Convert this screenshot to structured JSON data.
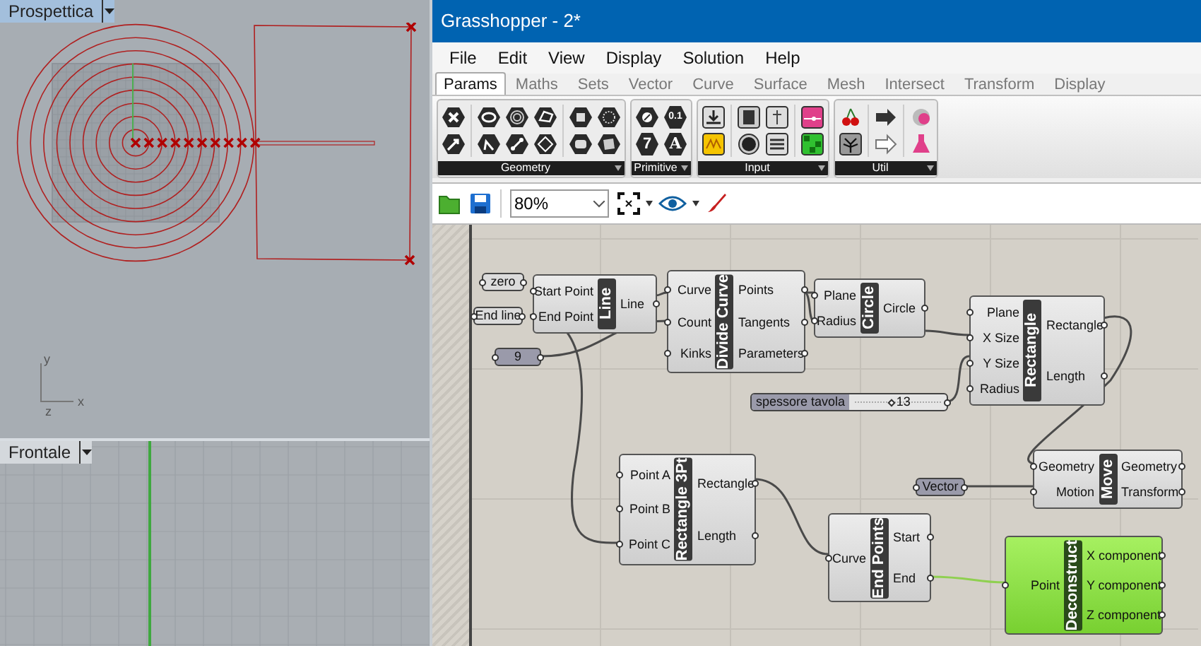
{
  "viewports": [
    {
      "label": "Prospettica",
      "selected": true,
      "axes": [
        "y",
        "x",
        "z"
      ]
    },
    {
      "label": "Frontale",
      "selected": false
    }
  ],
  "window": {
    "title": "Grasshopper - 2*"
  },
  "menu": [
    "File",
    "Edit",
    "View",
    "Display",
    "Solution",
    "Help"
  ],
  "tabs": [
    {
      "label": "Params",
      "selected": true
    },
    {
      "label": "Maths",
      "selected": false
    },
    {
      "label": "Sets",
      "selected": false
    },
    {
      "label": "Vector",
      "selected": false
    },
    {
      "label": "Curve",
      "selected": false
    },
    {
      "label": "Surface",
      "selected": false
    },
    {
      "label": "Mesh",
      "selected": false
    },
    {
      "label": "Intersect",
      "selected": false
    },
    {
      "label": "Transform",
      "selected": false
    },
    {
      "label": "Display",
      "selected": false
    }
  ],
  "ribbon_groups": [
    {
      "label": "Geometry"
    },
    {
      "label": "Primitive",
      "icon_glyphs": [
        "0.1",
        "7",
        "A"
      ]
    },
    {
      "label": "Input"
    },
    {
      "label": "Util"
    }
  ],
  "toolbar": {
    "zoom": "80%"
  },
  "components": [
    {
      "kind": "param",
      "shaded": false,
      "label": "zero"
    },
    {
      "kind": "param",
      "shaded": false,
      "label": "End line"
    },
    {
      "kind": "component",
      "selected": false,
      "title": "Line",
      "inputs": [
        "Start Point",
        "End Point"
      ],
      "outputs": [
        "Line"
      ]
    },
    {
      "kind": "param",
      "shaded": true,
      "label": "9"
    },
    {
      "kind": "component",
      "selected": false,
      "title": "Divide Curve",
      "inputs": [
        "Curve",
        "Count",
        "Kinks"
      ],
      "outputs": [
        "Points",
        "Tangents",
        "Parameters"
      ]
    },
    {
      "kind": "component",
      "selected": false,
      "title": "Circle",
      "inputs": [
        "Plane",
        "Radius"
      ],
      "outputs": [
        "Circle"
      ]
    },
    {
      "kind": "component",
      "selected": false,
      "title": "Rectangle",
      "inputs": [
        "Plane",
        "X Size",
        "Y Size",
        "Radius"
      ],
      "outputs": [
        "Rectangle",
        "Length"
      ]
    },
    {
      "kind": "slider",
      "label": "spessore tavola",
      "value": "13",
      "level": 0.4
    },
    {
      "kind": "component",
      "selected": false,
      "title": "Rectangle 3Pt",
      "inputs": [
        "Point A",
        "Point B",
        "Point C"
      ],
      "outputs": [
        "Rectangle",
        "Length"
      ]
    },
    {
      "kind": "param",
      "shaded": true,
      "label": "Vector"
    },
    {
      "kind": "component",
      "selected": false,
      "title": "Move",
      "inputs": [
        "Geometry",
        "Motion"
      ],
      "outputs": [
        "Geometry",
        "Transform"
      ]
    },
    {
      "kind": "component",
      "selected": false,
      "title": "End Points",
      "inputs": [
        "Curve"
      ],
      "outputs": [
        "Start",
        "End"
      ]
    },
    {
      "kind": "component",
      "selected": true,
      "title": "Deconstruct",
      "inputs": [
        "Point"
      ],
      "outputs": [
        "X component",
        "Y component",
        "Z component"
      ]
    }
  ]
}
